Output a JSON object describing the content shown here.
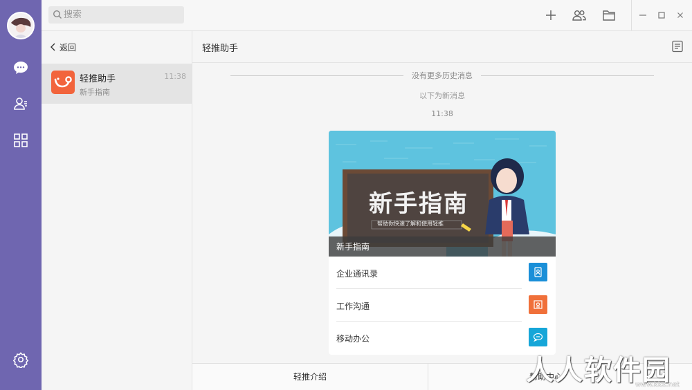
{
  "search": {
    "placeholder": "搜索"
  },
  "list": {
    "back_label": "返回",
    "items": [
      {
        "name": "轻推助手",
        "preview": "新手指南",
        "time": "11:38"
      }
    ]
  },
  "chat": {
    "title": "轻推助手",
    "history_label": "没有更多历史消息",
    "new_label": "以下为新消息",
    "time": "11:38",
    "card": {
      "banner_title": "新手指南",
      "banner_subtitle": "帮助你快速了解和使用轻推",
      "caption": "新手指南",
      "rows": [
        {
          "label": "企业通讯录",
          "icon": "contacts-icon",
          "color": "#1a8fd8"
        },
        {
          "label": "工作沟通",
          "icon": "chat-box-icon",
          "color": "#f0703a"
        },
        {
          "label": "移动办公",
          "icon": "mobile-office-icon",
          "color": "#16a6d8"
        }
      ]
    },
    "bottom": {
      "left": "轻推介绍",
      "right": "帮助中心"
    }
  },
  "watermark": {
    "text": "人人软件园",
    "sub": "www.kkx.net"
  },
  "colors": {
    "nav": "#6f66b0",
    "accent": "#f2643c"
  }
}
